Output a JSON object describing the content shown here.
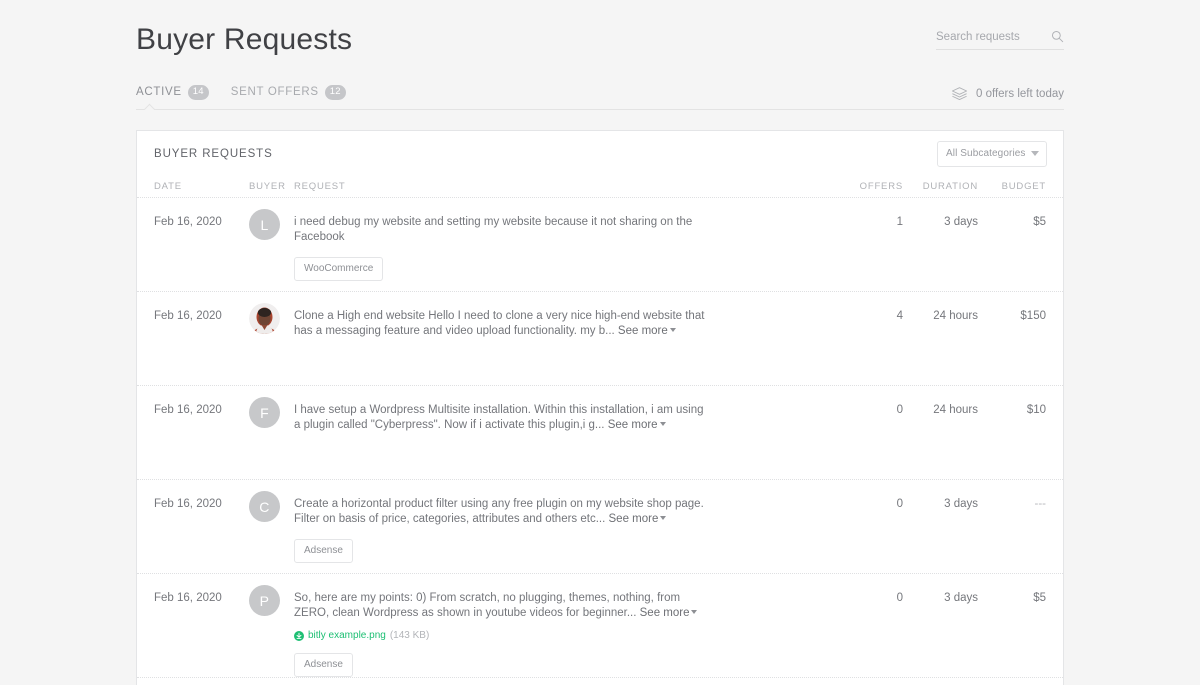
{
  "header": {
    "title": "Buyer Requests",
    "search": {
      "placeholder": "Search requests",
      "value": "",
      "icon": "search-icon"
    }
  },
  "tabs": [
    {
      "label": "ACTIVE",
      "badge": "14",
      "active": true
    },
    {
      "label": "SENT OFFERS",
      "badge": "12",
      "active": false
    }
  ],
  "offers_left": {
    "icon": "layers-icon",
    "text": "0 offers left today"
  },
  "card": {
    "title": "BUYER REQUESTS",
    "subcategory_filter": {
      "selected": "All Subcategories",
      "icon": "chevron-down-icon"
    },
    "columns": {
      "date": "DATE",
      "buyer": "BUYER",
      "request": "REQUEST",
      "offers": "OFFERS",
      "duration": "DURATION",
      "budget": "BUDGET"
    },
    "rows": [
      {
        "date": "Feb 16, 2020",
        "avatar_letter": "L",
        "avatar_type": "initial",
        "request": "i need debug my website and setting my website because it not sharing on the Facebook",
        "see_more": "",
        "attachment": null,
        "tag": "WooCommerce",
        "offers": "1",
        "duration": "3 days",
        "budget": "$5"
      },
      {
        "date": "Feb 16, 2020",
        "avatar_letter": "",
        "avatar_type": "photo",
        "request": "Clone a High end website Hello I need to clone a very nice high-end website that has a messaging feature and video upload functionality. my b...",
        "see_more": "See more",
        "attachment": null,
        "tag": null,
        "offers": "4",
        "duration": "24 hours",
        "budget": "$150"
      },
      {
        "date": "Feb 16, 2020",
        "avatar_letter": "F",
        "avatar_type": "initial",
        "request": "I have setup a Wordpress Multisite installation. Within this installation, i am using a plugin called \"Cyberpress\". Now if i activate this plugin,i g...",
        "see_more": "See more",
        "attachment": null,
        "tag": null,
        "offers": "0",
        "duration": "24 hours",
        "budget": "$10"
      },
      {
        "date": "Feb 16, 2020",
        "avatar_letter": "C",
        "avatar_type": "initial",
        "request": "Create a horizontal product filter using any free plugin on my website shop page. Filter on basis of price, categories, attributes and others etc...",
        "see_more": "See more",
        "attachment": null,
        "tag": "Adsense",
        "offers": "0",
        "duration": "3 days",
        "budget": "---"
      },
      {
        "date": "Feb 16, 2020",
        "avatar_letter": "P",
        "avatar_type": "initial",
        "request": "So, here are my points: 0) From scratch, no plugging, themes, nothing, from ZERO, clean Wordpress as shown in youtube videos for beginner...",
        "see_more": "See more",
        "attachment": {
          "name": "bitly example.png",
          "size": "(143 KB)",
          "icon": "download-icon"
        },
        "tag": "Adsense",
        "offers": "0",
        "duration": "3 days",
        "budget": "$5"
      }
    ]
  },
  "colors": {
    "page_background": "#f5f5f5",
    "card_background": "#ffffff",
    "border": "#e4e5e7",
    "text_primary": "#404145",
    "text_secondary": "#74767b",
    "text_muted": "#b0b2b6",
    "badge_background": "#c5c6c9",
    "link_green": "#1dbf73"
  }
}
